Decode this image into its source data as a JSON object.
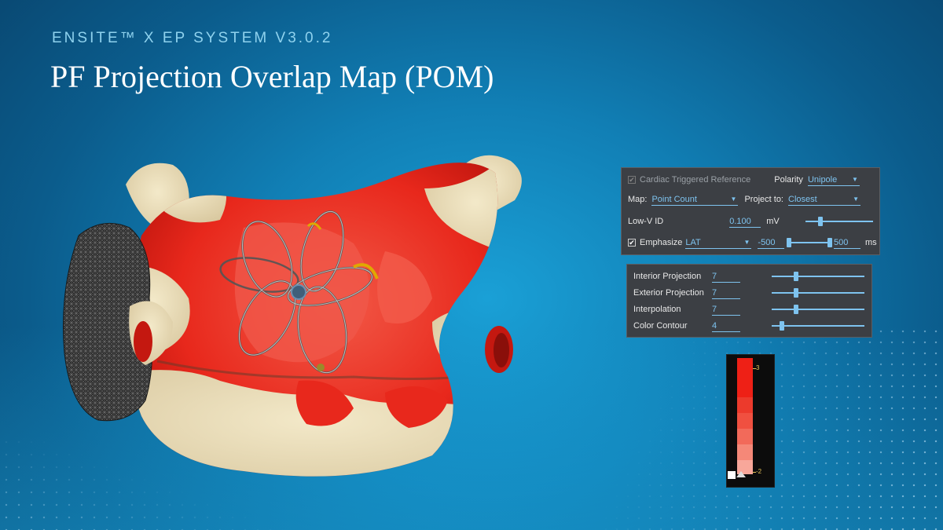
{
  "slide": {
    "eyebrow": "ENSITE™ X EP SYSTEM V3.0.2",
    "title": "PF Projection Overlap Map (POM)"
  },
  "map_panel": {
    "cardiac_triggered_label": "Cardiac Triggered Reference",
    "cardiac_triggered_checked": true,
    "polarity_label": "Polarity",
    "polarity_value": "Unipole",
    "map_label": "Map:",
    "map_value": "Point Count",
    "project_to_label": "Project to:",
    "project_to_value": "Closest",
    "lowv_label": "Low-V ID",
    "lowv_value": "0.100",
    "lowv_unit": "mV",
    "emphasize_label": "Emphasize",
    "emphasize_checked": true,
    "emphasize_value": "LAT",
    "range_min": "-500",
    "range_max": "500",
    "range_unit": "ms"
  },
  "projection_panel": {
    "rows": [
      {
        "label": "Interior Projection",
        "value": "7"
      },
      {
        "label": "Exterior Projection",
        "value": "7"
      },
      {
        "label": "Interpolation",
        "value": "7"
      },
      {
        "label": "Color Contour",
        "value": "4"
      }
    ]
  },
  "color_scale": {
    "max_label": "3",
    "min_label": "-2"
  },
  "colors": {
    "accent_blue": "#7ec3ef",
    "panel_bg": "#3c3f44",
    "map_red": "#e8231a",
    "map_light_red": "#f04b3c",
    "tissue_cream": "#eee2bf"
  },
  "icons": {
    "dropdown": "caret-down-icon",
    "checkbox": "checkbox-icon"
  }
}
